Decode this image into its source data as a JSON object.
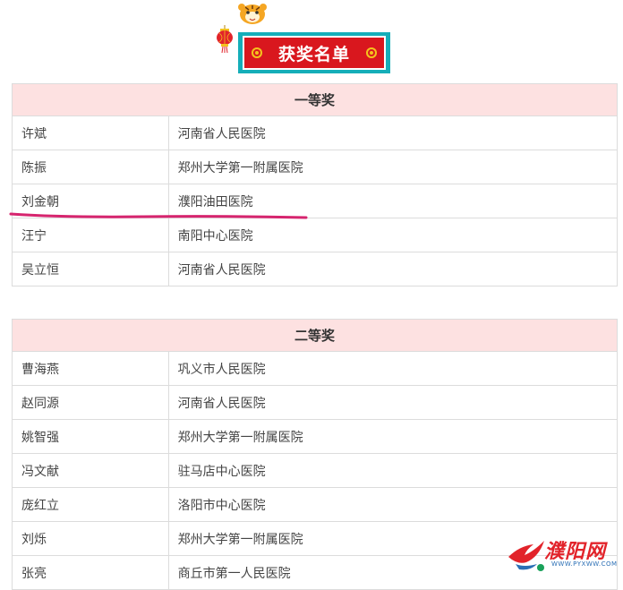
{
  "banner": {
    "title": "获奖名单"
  },
  "colors": {
    "banner_red": "#d9171e",
    "banner_teal": "#15aeb9",
    "header_bg": "#fde1e1",
    "highlight_stroke": "#d6246e",
    "watermark_red": "#e2232a"
  },
  "first_prize": {
    "heading": "一等奖",
    "rows": [
      {
        "name": "许斌",
        "org": "河南省人民医院"
      },
      {
        "name": "陈振",
        "org": "郑州大学第一附属医院"
      },
      {
        "name": "刘金朝",
        "org": "濮阳油田医院"
      },
      {
        "name": "汪宁",
        "org": "南阳中心医院"
      },
      {
        "name": "吴立恒",
        "org": "河南省人民医院"
      }
    ]
  },
  "second_prize": {
    "heading": "二等奖",
    "rows": [
      {
        "name": "曹海燕",
        "org": "巩义市人民医院"
      },
      {
        "name": "赵同源",
        "org": "河南省人民医院"
      },
      {
        "name": "姚智强",
        "org": "郑州大学第一附属医院"
      },
      {
        "name": "冯文献",
        "org": "驻马店中心医院"
      },
      {
        "name": "庞红立",
        "org": "洛阳市中心医院"
      },
      {
        "name": "刘烁",
        "org": "郑州大学第一附属医院"
      },
      {
        "name": "张亮",
        "org": "商丘市第一人民医院"
      }
    ]
  },
  "watermark": {
    "text": "濮阳网",
    "url": "WWW.PYXWW.COM",
    "icon": "bird-logo-icon"
  },
  "decorations": {
    "mascot_icon": "tiger-mascot-icon",
    "lantern_icon": "lantern-icon",
    "coin_icon": "coin-icon"
  }
}
